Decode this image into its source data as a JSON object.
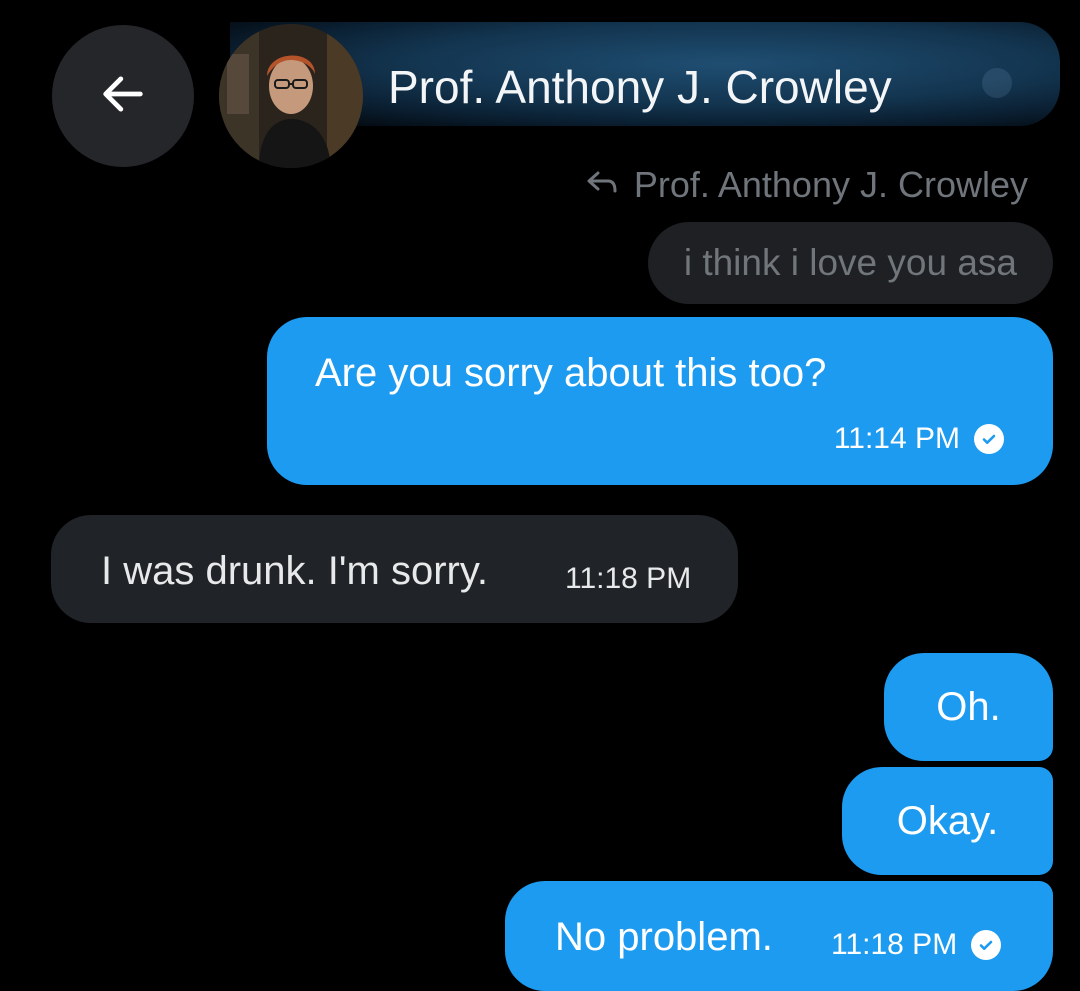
{
  "header": {
    "contact_name": "Prof. Anthony J. Crowley",
    "back_icon": "arrow-left-icon"
  },
  "reply_context": {
    "reply_to_name": "Prof. Anthony J. Crowley",
    "reply_icon": "reply-arrow-icon",
    "quoted_text": "i think i love you asa"
  },
  "messages": [
    {
      "direction": "outgoing",
      "text": "Are you sorry about this too?",
      "time": "11:14 PM",
      "read": true
    },
    {
      "direction": "incoming",
      "text": "I was drunk. I'm sorry.",
      "time": "11:18 PM"
    },
    {
      "direction": "outgoing",
      "text": "Oh."
    },
    {
      "direction": "outgoing",
      "text": "Okay."
    },
    {
      "direction": "outgoing",
      "text": "No problem.",
      "time": "11:18 PM",
      "read": true
    }
  ],
  "colors": {
    "background": "#000000",
    "outgoing_bubble": "#1d9bf0",
    "incoming_bubble": "#202327",
    "quoted_bubble": "#1e2024",
    "muted_text": "#71767b"
  }
}
